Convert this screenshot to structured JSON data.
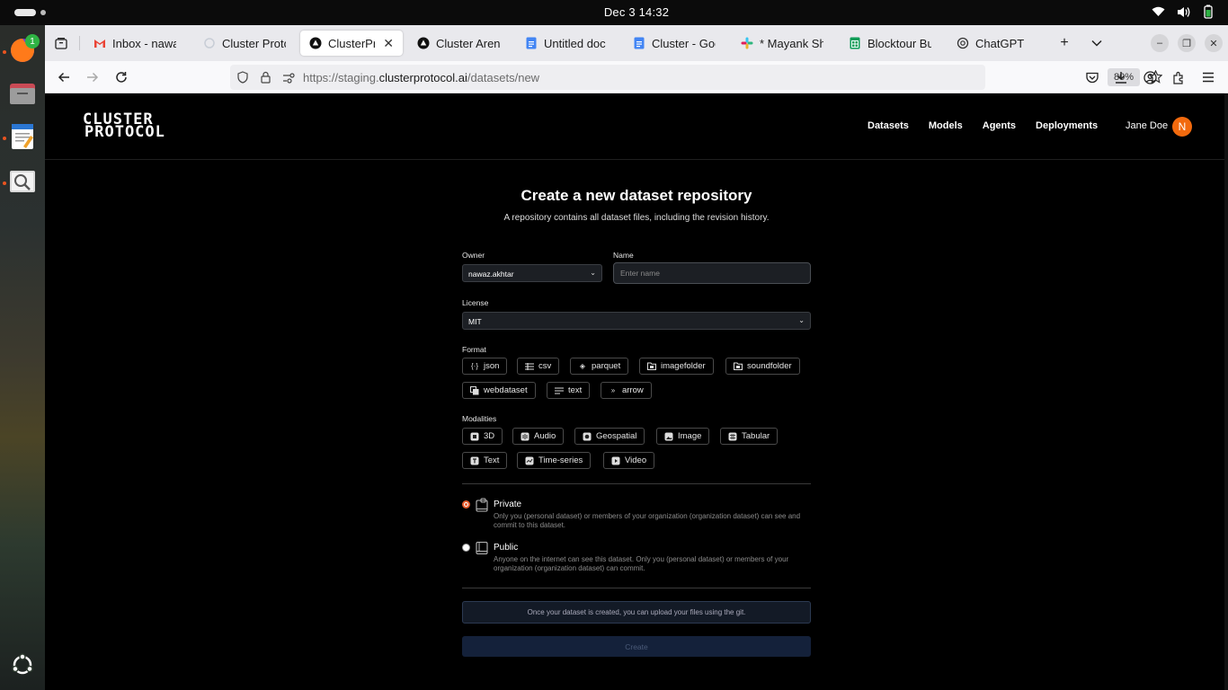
{
  "system": {
    "clock": "Dec 3  14:32",
    "dock_badge": "1"
  },
  "browser": {
    "tabs": [
      {
        "title": "Inbox - nawa",
        "icon": "gmail-icon"
      },
      {
        "title": "Cluster Proto",
        "icon": "cluster-icon"
      },
      {
        "title": "ClusterPro",
        "icon": "triangle-icon"
      },
      {
        "title": "Cluster Aren",
        "icon": "triangle-icon"
      },
      {
        "title": "Untitled doc",
        "icon": "docs-icon"
      },
      {
        "title": "Cluster - Goo",
        "icon": "docs-icon"
      },
      {
        "title": "* Mayank Sha",
        "icon": "slack-icon"
      },
      {
        "title": "Blocktour Bu",
        "icon": "sheets-icon"
      },
      {
        "title": "ChatGPT",
        "icon": "chatgpt-icon"
      }
    ],
    "url_prefix": "https://staging.",
    "url_domain": "clusterprotocol.ai",
    "url_path": "/datasets/new",
    "zoom": "80%"
  },
  "site": {
    "logo_line1": "CLUSTER",
    "logo_line2": "PROTOCOL",
    "nav": [
      "Datasets",
      "Models",
      "Agents",
      "Deployments"
    ],
    "user_name": "Jane Doe",
    "avatar_initial": "N"
  },
  "form": {
    "title": "Create a new dataset repository",
    "subtitle": "A repository contains all dataset files, including the revision history.",
    "owner_label": "Owner",
    "owner_value": "nawaz.akhtar",
    "name_label": "Name",
    "name_placeholder": "Enter name",
    "license_label": "License",
    "license_value": "MIT",
    "format_label": "Format",
    "formats": [
      "json",
      "csv",
      "parquet",
      "imagefolder",
      "soundfolder",
      "webdataset",
      "text",
      "arrow"
    ],
    "modalities_label": "Modalities",
    "modalities": [
      "3D",
      "Audio",
      "Geospatial",
      "Image",
      "Tabular",
      "Text",
      "Time-series",
      "Video"
    ],
    "private_title": "Private",
    "private_desc": "Only you (personal dataset) or members of your organization (organization dataset) can see and commit to this dataset.",
    "public_title": "Public",
    "public_desc": "Anyone on the internet can see this dataset. Only you (personal dataset) or members of your organization (organization dataset) can commit.",
    "note": "Once your dataset is created, you can upload your files using the git.",
    "create_label": "Create"
  },
  "colors": {
    "accent": "#f26a0e",
    "radio_selected": "#e55b2b",
    "page_bg": "#000000"
  }
}
